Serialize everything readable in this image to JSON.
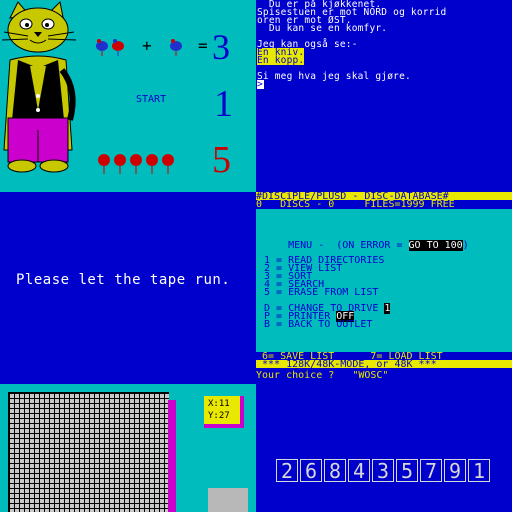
{
  "math_game": {
    "operator_plus": "+",
    "operator_equals": "=",
    "result": "3",
    "start_label": "START",
    "counter": "1",
    "mice_count": "5"
  },
  "adventure": {
    "lines": [
      "  Du er på kjøkkenet.",
      "Spisestuen er mot NORD og korrid",
      "oren er mot ØST.",
      "  Du kan se en komfyr.",
      "Jeg kan også se:-",
      "En kniv.",
      "En kopp.",
      "Si meg hva jeg skal gjøre.",
      ">"
    ]
  },
  "tape": {
    "message": "Please let the tape run."
  },
  "disc_db": {
    "title": "#DISCiPLE/PLUSD - DISC-DATABASE#",
    "status": "0   DISCS - 0     FILES=1999 FREE",
    "menu_prefix": "MENU -  (ON ERROR = ",
    "menu_goto": "GO TO 100",
    "menu_suffix": ")",
    "items": [
      "1 = READ DIRECTORIES",
      "2 = VIEW LIST",
      "3 = SORT",
      "4 = SEARCH",
      "5 = ERASE FROM LIST"
    ],
    "drive_label": "D = CHANGE TO DRIVE ",
    "drive_value": "1",
    "printer_label": "P = PRINTER ",
    "printer_value": "OFF",
    "back_label": "B = BACK TO OUTLET",
    "bottom_options": " 6= SAVE LIST      7= LOAD LIST",
    "mode_line": " *** 128K/48K-MODE, or 48K ***",
    "prompt": "Your choice ?   \"WOSC\""
  },
  "grid_editor": {
    "x_label": "X:11",
    "y_label": "Y:27"
  },
  "number_tiles": {
    "digits": [
      "2",
      "6",
      "8",
      "4",
      "3",
      "5",
      "7",
      "9",
      "1"
    ]
  },
  "colors": {
    "cyan": "#00bcbc",
    "blue": "#0000cc",
    "yellow": "#e8e800",
    "red": "#cc0000",
    "magenta": "#cc00cc",
    "black": "#000000",
    "white": "#ffffff"
  }
}
